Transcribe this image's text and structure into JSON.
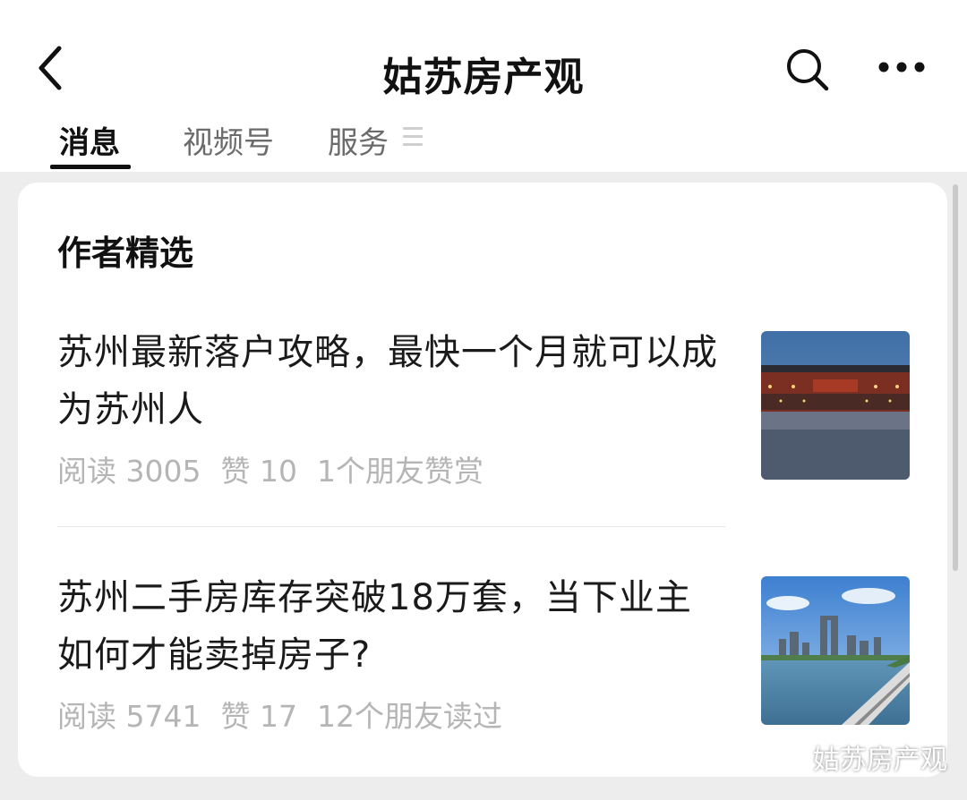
{
  "header": {
    "title": "姑苏房产观",
    "back_icon": "chevron-left-icon",
    "search_icon": "search-icon",
    "more_icon": "more-dots-icon"
  },
  "tabs": [
    {
      "label": "消息",
      "active": true
    },
    {
      "label": "视频号",
      "active": false
    },
    {
      "label": "服务",
      "active": false
    }
  ],
  "section": {
    "title": "作者精选"
  },
  "articles": [
    {
      "title": "苏州最新落户攻略，最快一个月就可以成为苏州人",
      "reads": "阅读 3005",
      "likes": "赞 10",
      "social": "1个朋友赞赏",
      "thumb": "train-station-night-thumbnail"
    },
    {
      "title": "苏州二手房库存突破18万套，当下业主如何才能卖掉房子?",
      "reads": "阅读 5741",
      "likes": "赞 17",
      "social": "12个朋友读过",
      "thumb": "city-skyline-lake-thumbnail"
    }
  ],
  "watermark": {
    "text": "姑苏房产观"
  },
  "colors": {
    "background": "#ededed",
    "card": "#ffffff",
    "meta_text": "#b5b5b5",
    "active_tab": "#111111"
  }
}
